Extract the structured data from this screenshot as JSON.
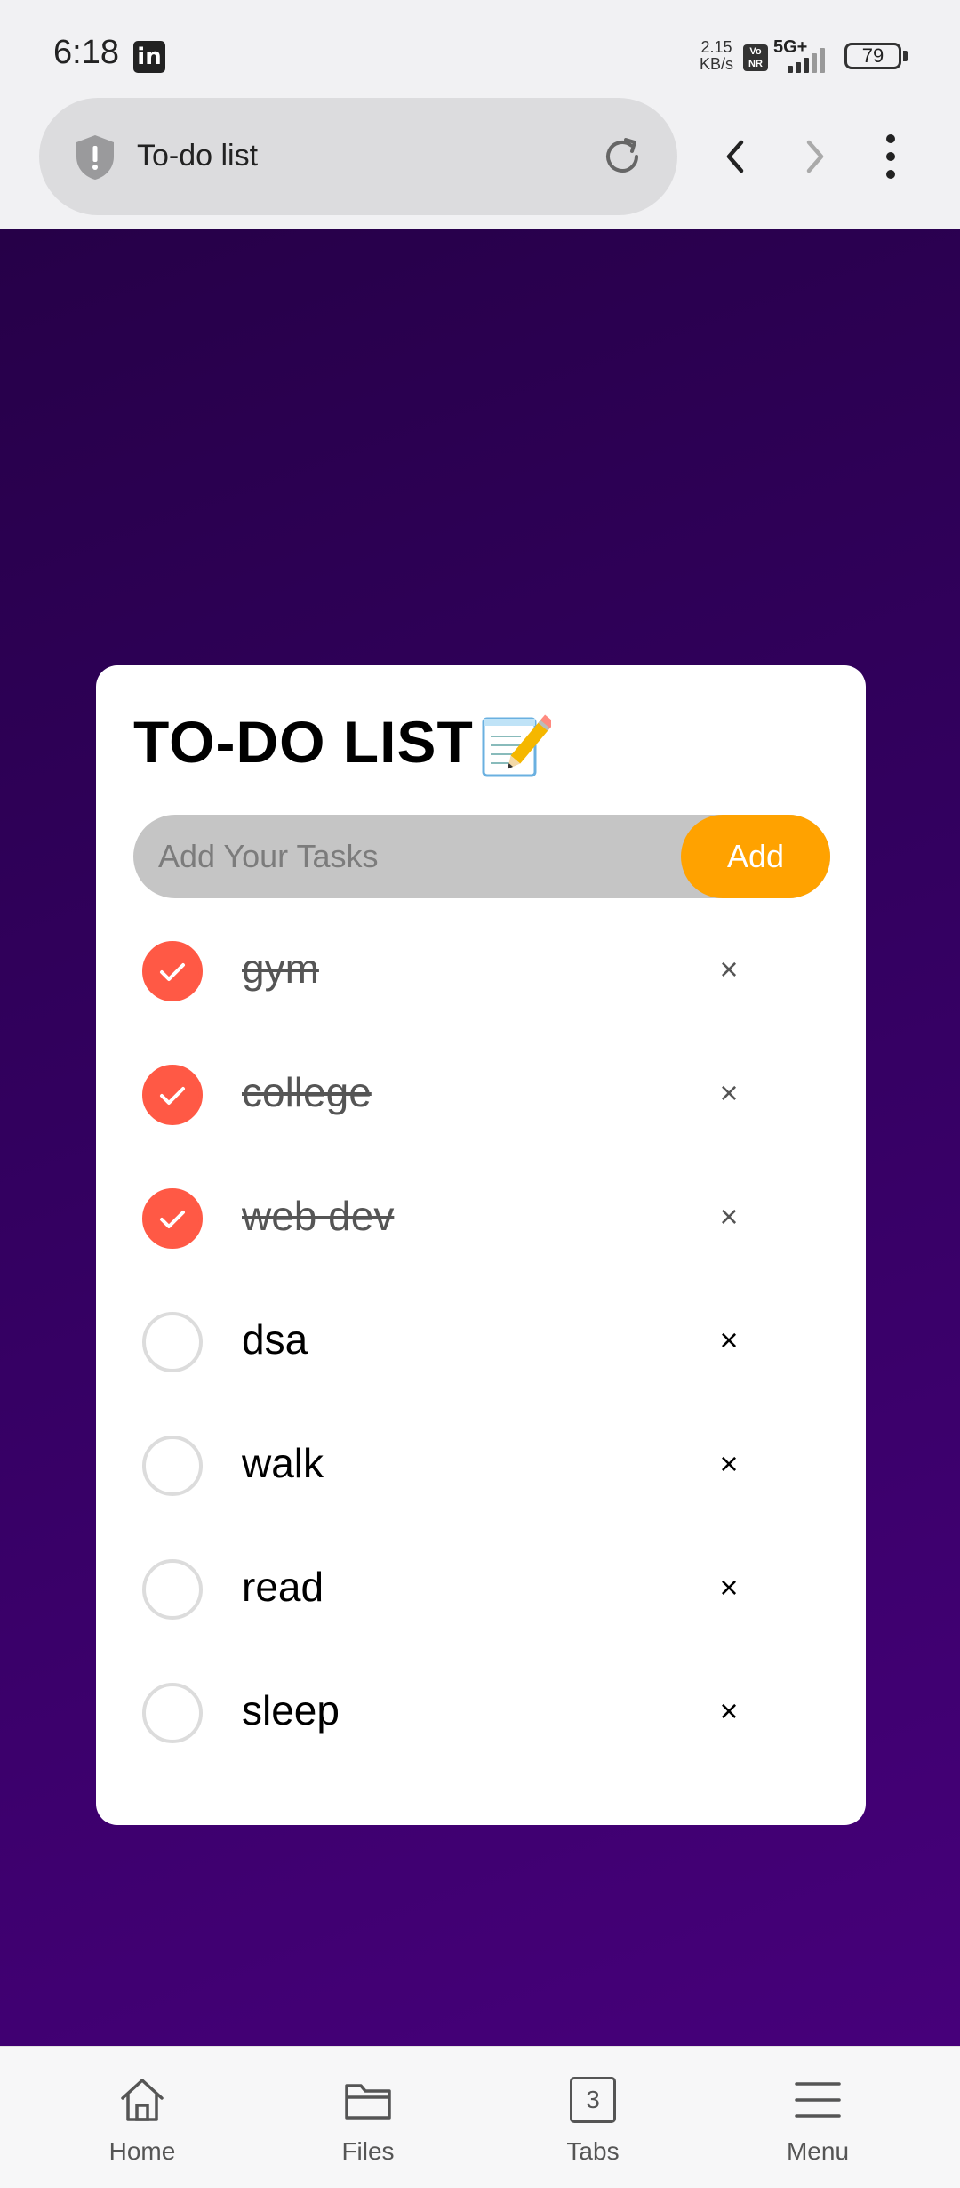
{
  "status_bar": {
    "time": "6:18",
    "app_icon": "linkedin-icon",
    "net_speed_value": "2.15",
    "net_speed_unit": "KB/s",
    "volte_label": "Vo NR",
    "network_label": "5G+",
    "battery_level": "79"
  },
  "browser": {
    "page_title": "To-do list",
    "icons": [
      "shield-icon",
      "reload-icon",
      "back-icon",
      "forward-icon",
      "menu-dots-icon"
    ]
  },
  "app": {
    "title": "TO-DO LIST",
    "title_icon": "memo-icon",
    "input_placeholder": "Add Your Tasks",
    "add_label": "Add",
    "delete_symbol": "×",
    "tasks": [
      {
        "text": "gym",
        "done": true
      },
      {
        "text": "college",
        "done": true
      },
      {
        "text": "web dev",
        "done": true
      },
      {
        "text": "dsa",
        "done": false
      },
      {
        "text": "walk",
        "done": false
      },
      {
        "text": "read",
        "done": false
      },
      {
        "text": "sleep",
        "done": false
      }
    ]
  },
  "bottom_nav": {
    "items": [
      {
        "label": "Home",
        "icon": "home-icon"
      },
      {
        "label": "Files",
        "icon": "folder-icon"
      },
      {
        "label": "Tabs",
        "icon": "tabs-icon",
        "count": "3"
      },
      {
        "label": "Menu",
        "icon": "hamburger-icon"
      }
    ]
  },
  "colors": {
    "accent_orange": "#ffa200",
    "check_red": "#ff5945",
    "background_purple": "#330060"
  }
}
